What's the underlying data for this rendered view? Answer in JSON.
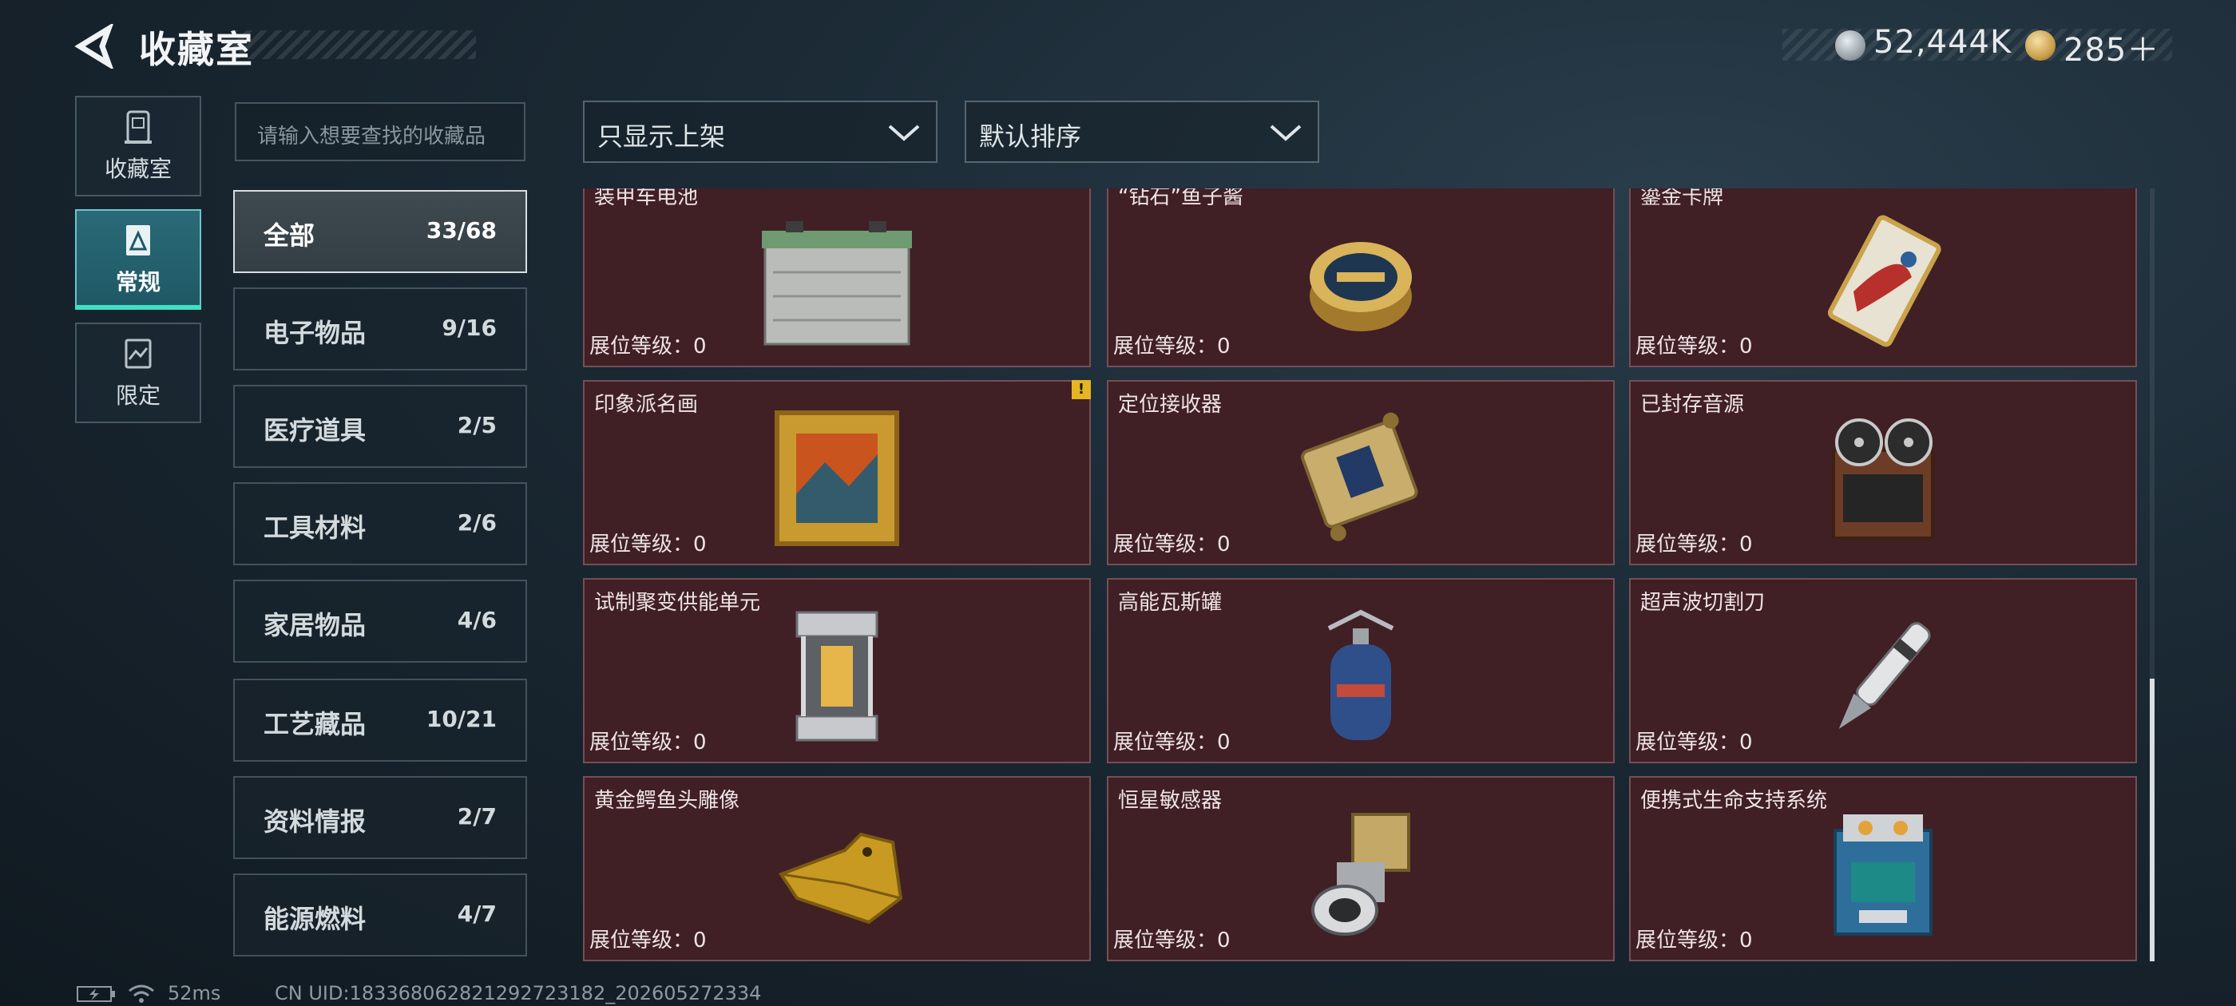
{
  "header": {
    "title": "收藏室",
    "currency_silver": "52,444K",
    "currency_gold": "285＋"
  },
  "left_tabs": [
    {
      "label": "收藏室",
      "icon": "collection-room-icon",
      "active": false
    },
    {
      "label": "常规",
      "icon": "regular-icon",
      "active": true
    },
    {
      "label": "限定",
      "icon": "limited-icon",
      "active": false
    }
  ],
  "search": {
    "placeholder": "请输入想要查找的收藏品"
  },
  "filters": {
    "shelf_filter": "只显示上架",
    "sort": "默认排序"
  },
  "categories": [
    {
      "name": "全部",
      "count": "33/68",
      "active": true
    },
    {
      "name": "电子物品",
      "count": "9/16",
      "active": false
    },
    {
      "name": "医疗道具",
      "count": "2/5",
      "active": false
    },
    {
      "name": "工具材料",
      "count": "2/6",
      "active": false
    },
    {
      "name": "家居物品",
      "count": "4/6",
      "active": false
    },
    {
      "name": "工艺藏品",
      "count": "10/21",
      "active": false
    },
    {
      "name": "资料情报",
      "count": "2/7",
      "active": false
    },
    {
      "name": "能源燃料",
      "count": "4/7",
      "active": false
    }
  ],
  "items": [
    {
      "name": "装甲车电池",
      "level": "展位等级：0"
    },
    {
      "name": "“钻石”鱼子酱",
      "level": "展位等级：0"
    },
    {
      "name": "鎏金卡牌",
      "level": "展位等级：0"
    },
    {
      "name": "印象派名画",
      "level": "展位等级：0"
    },
    {
      "name": "定位接收器",
      "level": "展位等级：0"
    },
    {
      "name": "已封存音源",
      "level": "展位等级：0"
    },
    {
      "name": "试制聚变供能单元",
      "level": "展位等级：0"
    },
    {
      "name": "高能瓦斯罐",
      "level": "展位等级：0"
    },
    {
      "name": "超声波切割刀",
      "level": "展位等级：0"
    },
    {
      "name": "黄金鳄鱼头雕像",
      "level": "展位等级：0"
    },
    {
      "name": "恒星敏感器",
      "level": "展位等级：0"
    },
    {
      "name": "便携式生命支持系统",
      "level": "展位等级：0"
    }
  ],
  "warning_badge": "!",
  "footer": {
    "ping": "52ms",
    "uid": "CN UID:18336806282129272318​2_202605272334"
  }
}
